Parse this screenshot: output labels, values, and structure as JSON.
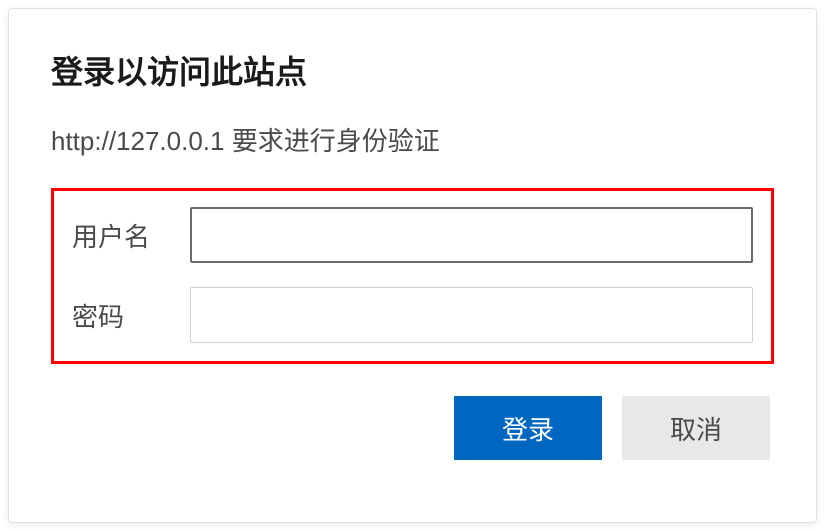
{
  "dialog": {
    "title": "登录以访问此站点",
    "subtitle": "http://127.0.0.1 要求进行身份验证",
    "fields": {
      "username": {
        "label": "用户名",
        "value": ""
      },
      "password": {
        "label": "密码",
        "value": ""
      }
    },
    "buttons": {
      "login": "登录",
      "cancel": "取消"
    }
  }
}
